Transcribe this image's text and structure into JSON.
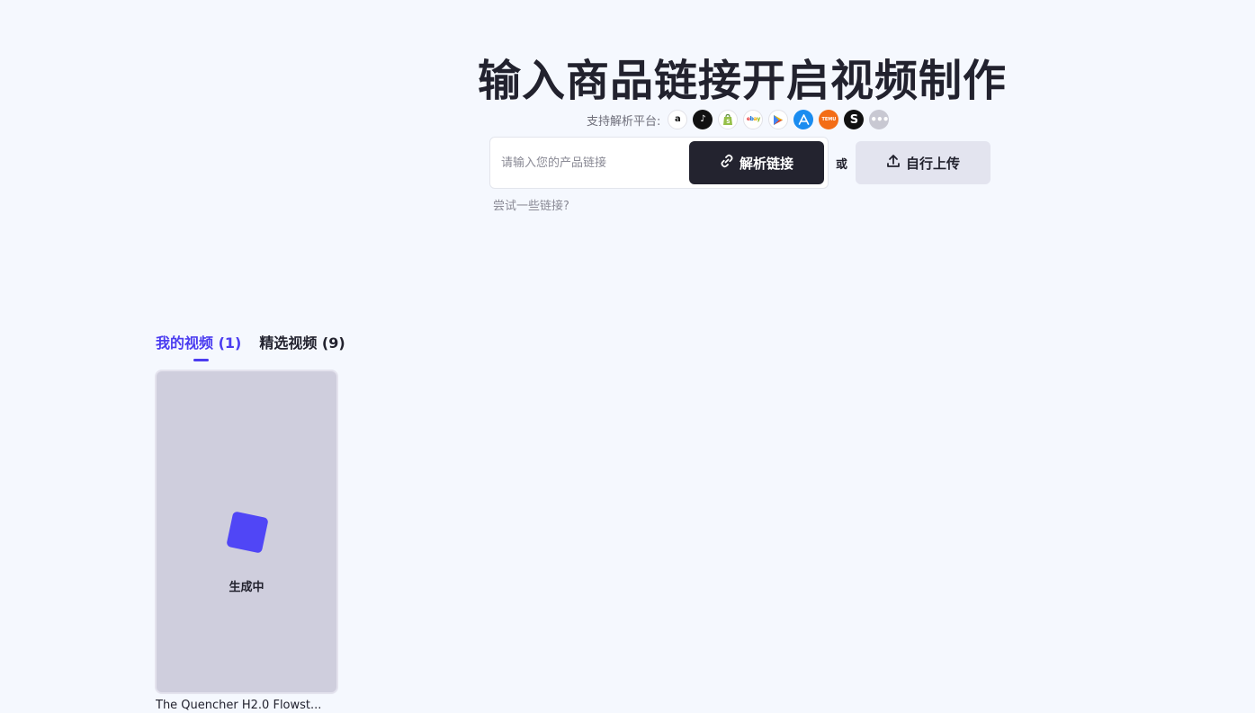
{
  "hero": {
    "title": "输入商品链接开启视频制作",
    "platforms_label": "支持解析平台:",
    "platforms": [
      {
        "name": "Amazon",
        "icon": "amazon-icon"
      },
      {
        "name": "TikTok",
        "icon": "tiktok-icon"
      },
      {
        "name": "Shopify",
        "icon": "shopify-icon"
      },
      {
        "name": "eBay",
        "icon": "ebay-icon"
      },
      {
        "name": "Google Play",
        "icon": "google-play-icon"
      },
      {
        "name": "App Store",
        "icon": "app-store-icon"
      },
      {
        "name": "Temu",
        "icon": "temu-icon"
      },
      {
        "name": "S",
        "icon": "s-icon"
      },
      {
        "name": "More",
        "icon": "more-icon"
      }
    ]
  },
  "link_input": {
    "placeholder": "请输入您的产品链接",
    "value": ""
  },
  "parse_button": {
    "label": "解析链接",
    "icon": "link-icon"
  },
  "or_label": "或",
  "upload_button": {
    "label": "自行上传",
    "icon": "upload-icon"
  },
  "try_links": "尝试一些链接?",
  "tabs": [
    {
      "label": "我的视频 (1)",
      "active": true
    },
    {
      "label": "精选视频 (9)",
      "active": false
    }
  ],
  "videos": [
    {
      "status": "生成中",
      "title": "The Quencher H2.0 Flowst..."
    }
  ],
  "colors": {
    "background": "#f5f8fe",
    "accent": "#4b3cf0",
    "primary_button": "#23232f",
    "secondary_button": "#e3e4ef",
    "card": "#cfcedd"
  }
}
